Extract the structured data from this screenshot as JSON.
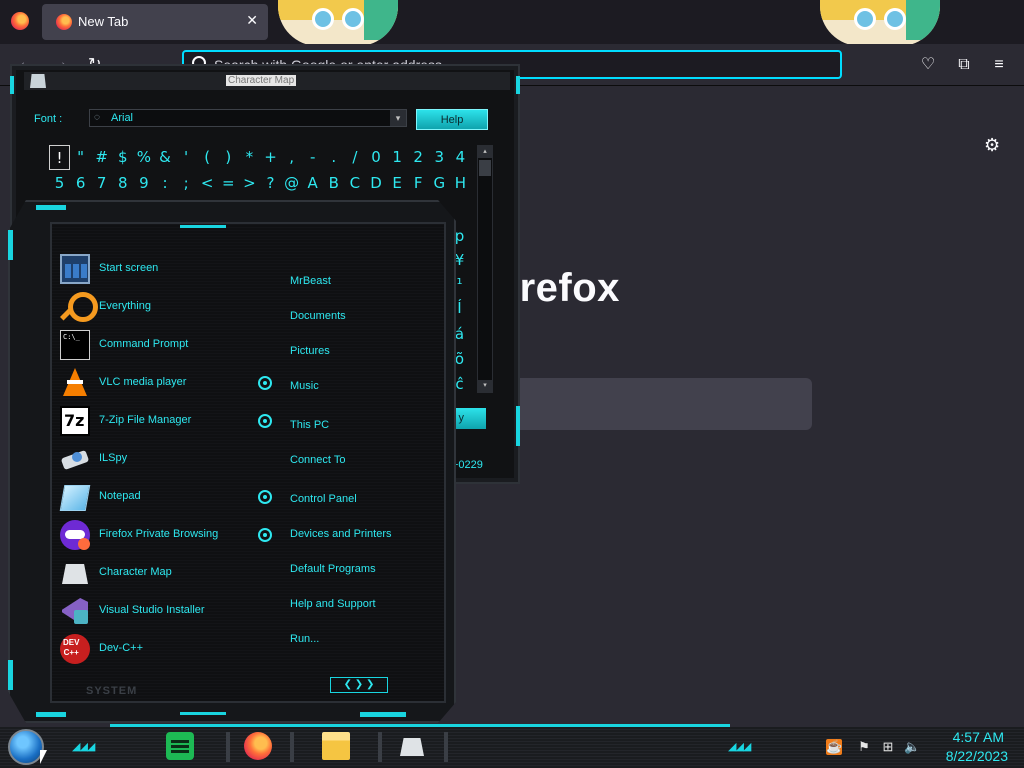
{
  "browser": {
    "tab": {
      "title": "New Tab",
      "close_glyph": "✕",
      "favicon": "firefox-icon"
    },
    "nav": {
      "back_glyph": "←",
      "forward_glyph": "→",
      "reload_glyph": "↻"
    },
    "urlbar": {
      "placeholder": "Search with Google or enter address",
      "value": ""
    },
    "toolbar_icons": [
      "pocket-icon",
      "extensions-icon",
      "menu-icon"
    ],
    "toolbar_glyphs": {
      "pocket": "♡",
      "extensions": "⧉",
      "menu": "≡"
    },
    "content": {
      "wordmark": "irefox",
      "settings_glyph": "⚙"
    },
    "accent_color": "#00ddff"
  },
  "charmap": {
    "title": "Character Map",
    "font_label": "Font :",
    "font_value": "Arial",
    "font_icon_glyph": "◌",
    "dropdown_glyph": "▾",
    "help_label": "Help",
    "copy_label": "y",
    "keystroke": "+0229",
    "scroll_up_glyph": "▴",
    "scroll_down_glyph": "▾",
    "rows": [
      [
        "!",
        "\"",
        "#",
        "$",
        "%",
        "&",
        "'",
        "(",
        ")",
        "*",
        "+",
        ",",
        "-",
        ".",
        "/",
        "0",
        "1",
        "2",
        "3",
        "4"
      ],
      [
        "5",
        "6",
        "7",
        "8",
        "9",
        ":",
        ";",
        "<",
        "=",
        ">",
        "?",
        "@",
        "A",
        "B",
        "C",
        "D",
        "E",
        "F",
        "G",
        "H"
      ]
    ],
    "right_column": [
      "p",
      "¥",
      "¹",
      "Í",
      "á",
      "õ",
      "ĉ"
    ],
    "accent_color": "#2ee8f0"
  },
  "startmenu": {
    "programs": [
      {
        "label": "Start screen",
        "icon": "start-screen-icon",
        "pinned_marker": false
      },
      {
        "label": "Everything",
        "icon": "everything-icon",
        "pinned_marker": false
      },
      {
        "label": "Command Prompt",
        "icon": "command-prompt-icon",
        "pinned_marker": false
      },
      {
        "label": "VLC media player",
        "icon": "vlc-icon",
        "pinned_marker": true
      },
      {
        "label": "7-Zip File Manager",
        "icon": "7zip-icon",
        "pinned_marker": true
      },
      {
        "label": "ILSpy",
        "icon": "ilspy-icon",
        "pinned_marker": false
      },
      {
        "label": "Notepad",
        "icon": "notepad-icon",
        "pinned_marker": true
      },
      {
        "label": "Firefox Private Browsing",
        "icon": "firefox-private-icon",
        "pinned_marker": true
      },
      {
        "label": "Character Map",
        "icon": "character-map-icon",
        "pinned_marker": false
      },
      {
        "label": "Visual Studio Installer",
        "icon": "visual-studio-installer-icon",
        "pinned_marker": false
      },
      {
        "label": "Dev-C++",
        "icon": "devcpp-icon",
        "pinned_marker": false
      }
    ],
    "links": [
      "MrBeast",
      "Documents",
      "Pictures",
      "Music",
      "This PC",
      "Connect To",
      "Control Panel",
      "Devices and Printers",
      "Default Programs",
      "Help and Support",
      "Run..."
    ],
    "system_label": "SYSTEM",
    "arrows_glyph": "❮ ❯ ❯",
    "accent_color": "#19d5e0"
  },
  "taskbar": {
    "apps": [
      "spotify-icon",
      "firefox-icon",
      "file-explorer-icon",
      "character-map-icon"
    ],
    "deco_glyph": "◢◢◢",
    "tray": {
      "java_glyph": "☕",
      "flag_glyph": "⚑",
      "network_glyph": "⊞",
      "volume_glyph": "🔈"
    },
    "clock": {
      "time": "4:57 AM",
      "date": "8/22/2023"
    }
  }
}
